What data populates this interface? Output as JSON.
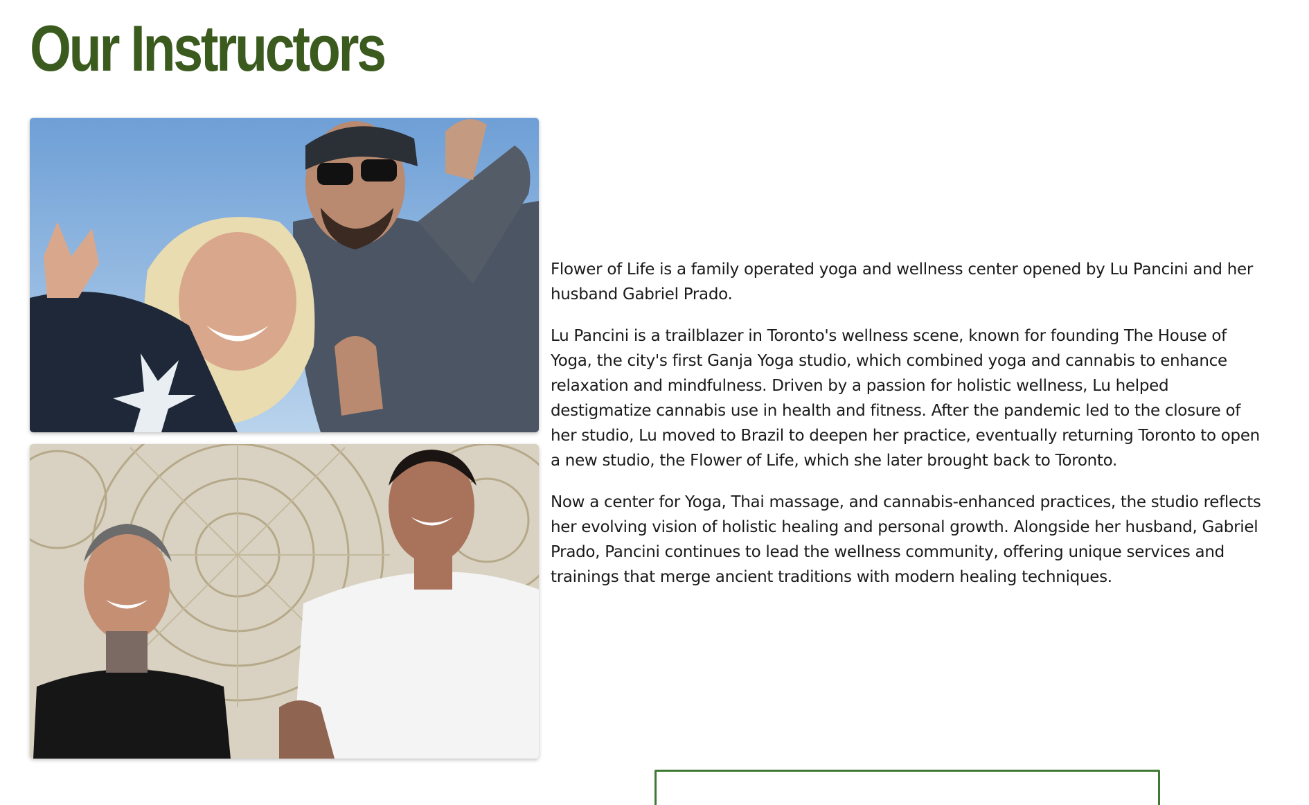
{
  "section": {
    "title": "Our Instructors"
  },
  "bio": {
    "paragraphs": [
      "Flower of Life is a family operated yoga and wellness center opened by Lu Pancini and her husband Gabriel Prado.",
      "Lu Pancini is a trailblazer in Toronto's wellness scene, known for founding The House of Yoga, the city's first Ganja Yoga studio, which combined yoga and cannabis to enhance relaxation and mindfulness. Driven by a passion for holistic wellness, Lu helped destigmatize cannabis use in health and fitness. After the pandemic led to the closure of her studio, Lu moved to Brazil to deepen her practice, eventually returning Toronto to open a new studio, the Flower of Life, which she later brought back to Toronto.",
      "Now a center for Yoga, Thai massage, and cannabis-enhanced practices, the studio reflects her evolving vision of holistic healing and personal growth. Alongside her husband, Gabriel Prado, Pancini continues to lead the wellness community, offering unique services and trainings that merge ancient traditions with modern healing techniques."
    ]
  },
  "colors": {
    "title_green": "#3a5a1e",
    "box_border_green": "#3f7a34",
    "text": "#1a1a1a"
  }
}
